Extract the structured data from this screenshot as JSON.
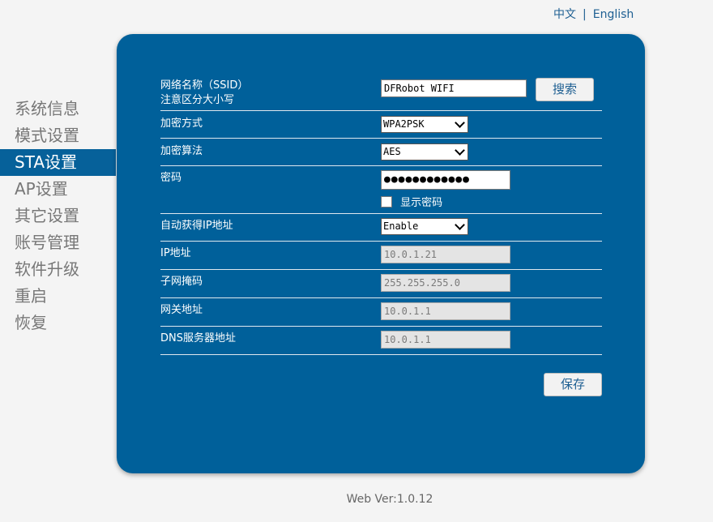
{
  "lang": {
    "chinese": "中文",
    "separator": "|",
    "english": "English"
  },
  "nav": {
    "items": [
      {
        "label": "系统信息"
      },
      {
        "label": "模式设置"
      },
      {
        "label": "STA设置"
      },
      {
        "label": "AP设置"
      },
      {
        "label": "其它设置"
      },
      {
        "label": "账号管理"
      },
      {
        "label": "软件升级"
      },
      {
        "label": "重启"
      },
      {
        "label": "恢复"
      }
    ],
    "active_index": 2
  },
  "form": {
    "ssid": {
      "label_line1": "网络名称（SSID）",
      "label_line2": "注意区分大小写",
      "value": "DFRobot WIFI",
      "scan_button": "搜索"
    },
    "encryption": {
      "label": "加密方式",
      "value": "WPA2PSK"
    },
    "algorithm": {
      "label": "加密算法",
      "value": "AES"
    },
    "password": {
      "label": "密码",
      "masked_value": "●●●●●●●●●●●●",
      "show_label": "显示密码",
      "show_checked": false
    },
    "dhcp": {
      "label": "自动获得IP地址",
      "value": "Enable"
    },
    "ip": {
      "label": "IP地址",
      "value": "10.0.1.21"
    },
    "mask": {
      "label": "子网掩码",
      "value": "255.255.255.0"
    },
    "gateway": {
      "label": "网关地址",
      "value": "10.0.1.1"
    },
    "dns": {
      "label": "DNS服务器地址",
      "value": "10.0.1.1"
    },
    "save_button": "保存"
  },
  "footer": {
    "version": "Web Ver:1.0.12"
  }
}
